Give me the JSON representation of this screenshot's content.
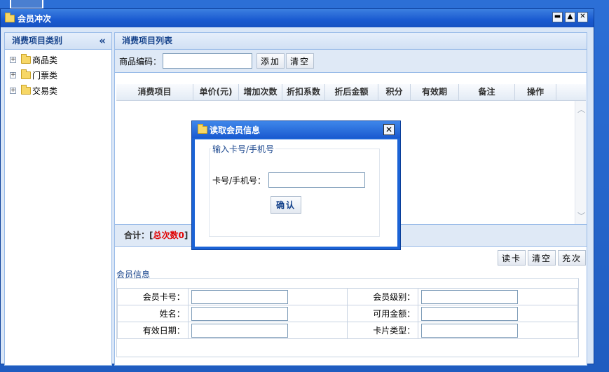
{
  "window": {
    "title": "会员冲次",
    "buttons": {
      "minimize": "▬",
      "maximize": "▲",
      "close": "✕"
    }
  },
  "sidebar": {
    "title": "消费项目类别",
    "collapse_icon": "«",
    "items": [
      {
        "label": "商品类",
        "expander": "+"
      },
      {
        "label": "门票类",
        "expander": "+"
      },
      {
        "label": "交易类",
        "expander": "+"
      }
    ]
  },
  "main": {
    "title": "消费项目列表",
    "toolbar": {
      "code_label": "商品编码：",
      "code_value": "",
      "add_label": "添加",
      "clear_label": "清空"
    },
    "grid": {
      "columns": [
        "消费项目",
        "单价(元)",
        "增加次数",
        "折扣系数",
        "折后金额",
        "积分",
        "有效期",
        "备注",
        "操作"
      ],
      "rows": []
    },
    "total": {
      "label": "合计：",
      "open": "[",
      "count_text": "总次数0",
      "close": "]"
    },
    "actions": {
      "read_card": "读卡",
      "clear": "清空",
      "recharge": "充次"
    }
  },
  "member_info": {
    "legend": "会员信息",
    "card_no_label": "会员卡号：",
    "level_label": "会员级别：",
    "name_label": "姓名：",
    "balance_label": "可用金额：",
    "expiry_label": "有效日期：",
    "card_type_label": "卡片类型："
  },
  "dialog": {
    "title": "读取会员信息",
    "legend": "输入卡号/手机号",
    "field_label": "卡号/手机号：",
    "field_value": "",
    "ok_label": "确认"
  },
  "colors": {
    "title_blue": "#1a5ad0",
    "panel_header": "#15428b",
    "total_red": "#e00000"
  }
}
